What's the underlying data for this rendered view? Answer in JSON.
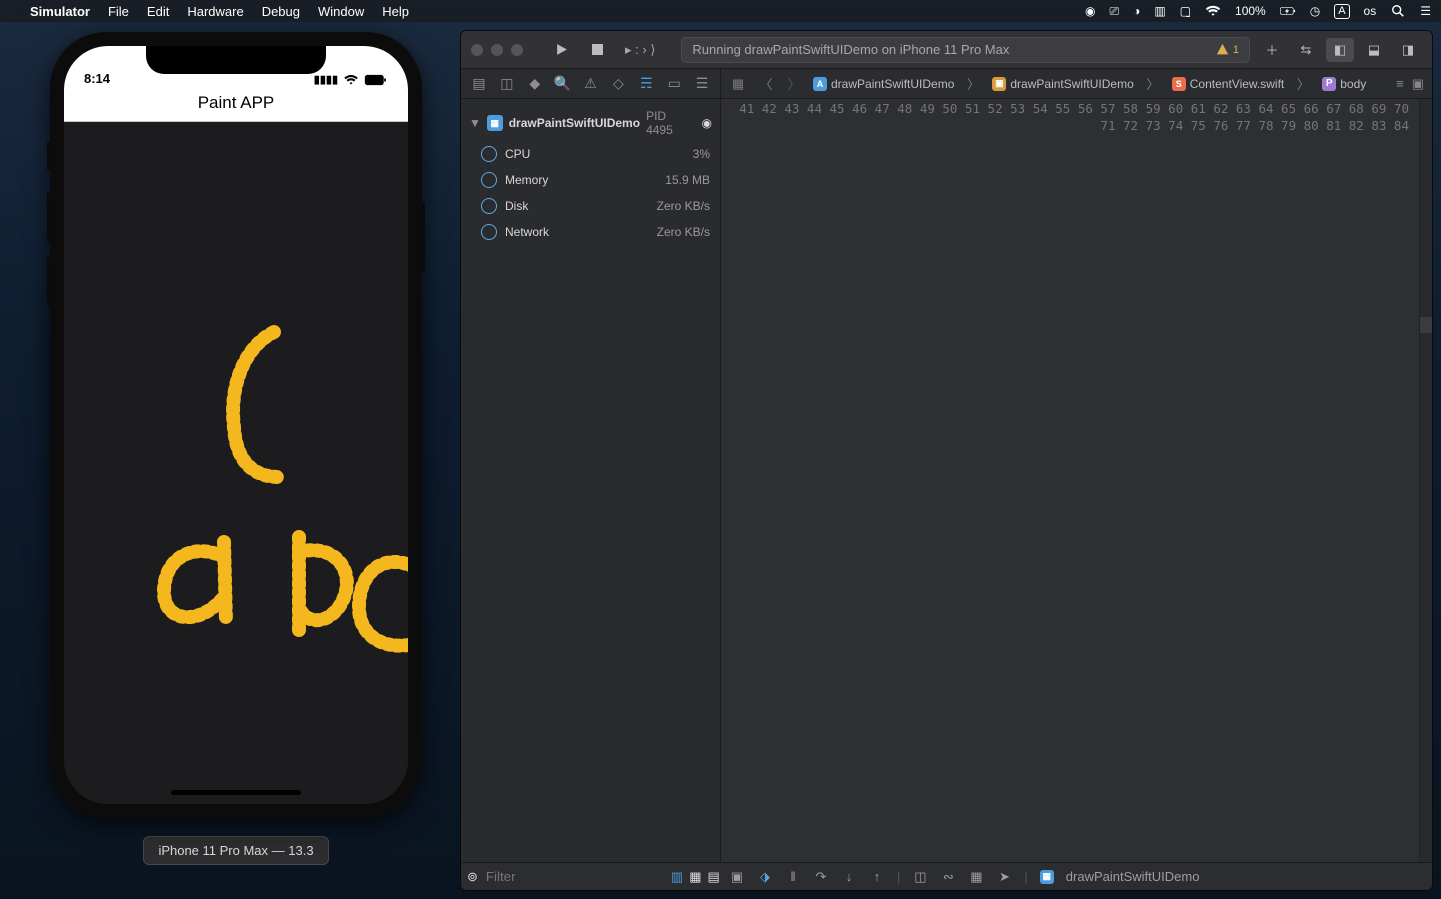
{
  "menubar": {
    "app": "Simulator",
    "items": [
      "File",
      "Edit",
      "Hardware",
      "Debug",
      "Window",
      "Help"
    ],
    "battery": "100%",
    "user": "os"
  },
  "simulator": {
    "clock": "8:14",
    "app_title": "Paint APP",
    "footer": "iPhone 11 Pro Max — 13.3"
  },
  "xcode": {
    "scheme_left": "▸ :",
    "scheme_right": "› ⟩",
    "status_text": "Running drawPaintSwiftUIDemo on iPhone 11 Pro Max",
    "warn_count": "1",
    "breadcrumb": {
      "project": "drawPaintSwiftUIDemo",
      "folder": "drawPaintSwiftUIDemo",
      "file": "ContentView.swift",
      "scope": "body"
    },
    "process": {
      "name": "drawPaintSwiftUIDemo",
      "pid": "PID 4495"
    },
    "gauges": [
      {
        "label": "CPU",
        "value": "3%"
      },
      {
        "label": "Memory",
        "value": "15.9 MB"
      },
      {
        "label": "Disk",
        "value": "Zero KB/s"
      },
      {
        "label": "Network",
        "value": "Zero KB/s"
      }
    ],
    "filter_placeholder": "Filter",
    "bottom_target": "drawPaintSwiftUIDemo",
    "lines_start": 41,
    "lines_end": 84
  }
}
